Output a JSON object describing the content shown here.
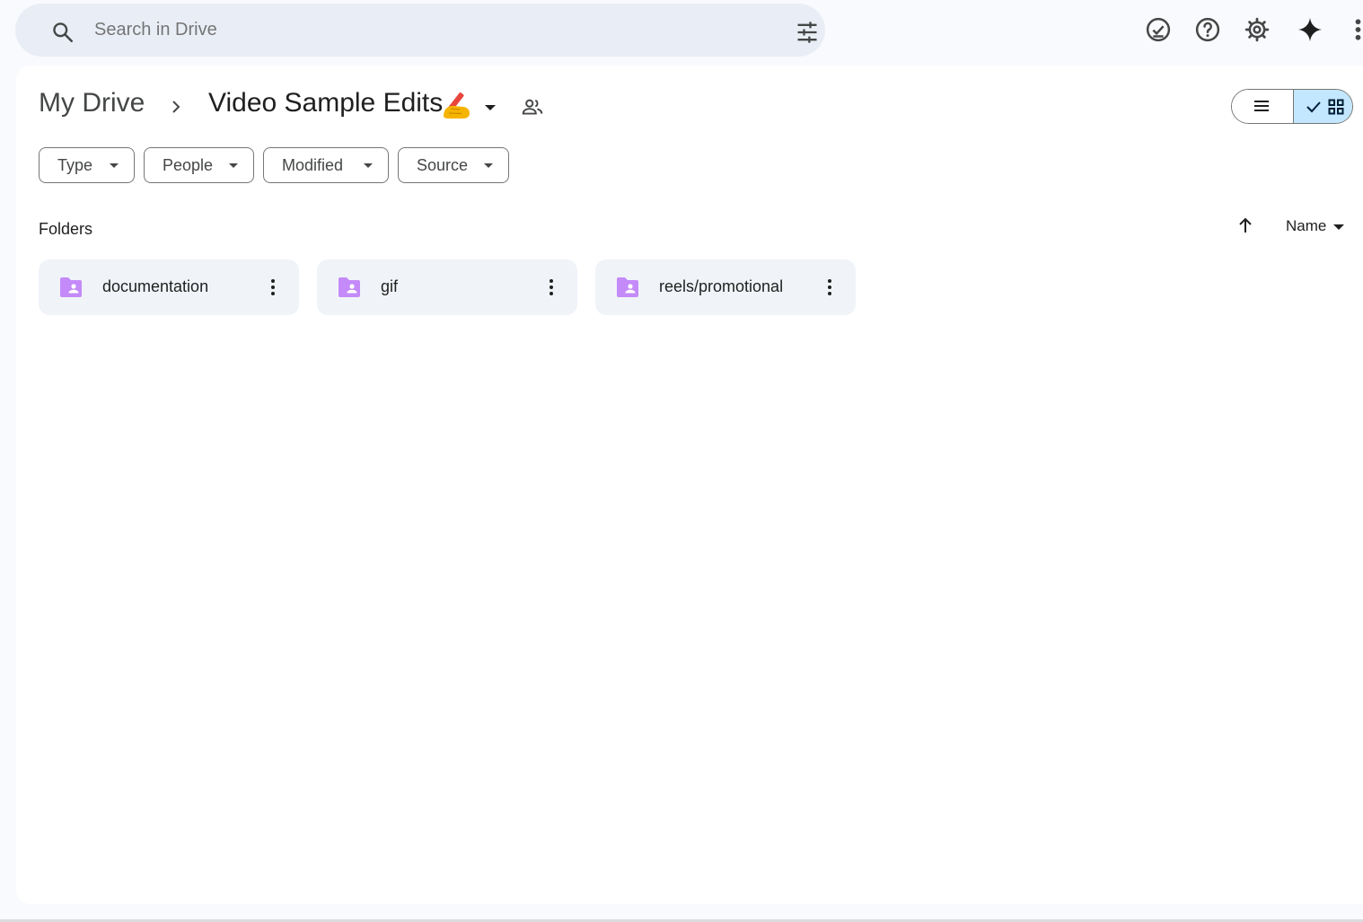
{
  "search": {
    "placeholder": "Search in Drive"
  },
  "top_icons": [
    "ready-for-offline-icon",
    "help-icon",
    "settings-icon",
    "gemini-spark-icon",
    "apps-grid-icon"
  ],
  "breadcrumb": {
    "root": "My Drive",
    "current": "Video Sample Edits",
    "emoji": "writing-hand-emoji"
  },
  "view": {
    "selected": "grid"
  },
  "filters": [
    {
      "label": "Type"
    },
    {
      "label": "People"
    },
    {
      "label": "Modified"
    },
    {
      "label": "Source"
    }
  ],
  "section": {
    "title": "Folders"
  },
  "sort": {
    "field": "Name",
    "direction": "ascending"
  },
  "folders": [
    {
      "name": "documentation"
    },
    {
      "name": "gif"
    },
    {
      "name": "reels/promotional"
    }
  ],
  "colors": {
    "background": "#f8fafd",
    "search_bg": "#e9eef6",
    "card_bg": "#f0f4f9",
    "folder_icon": "#c58af9",
    "view_selected": "#c2e7ff"
  }
}
